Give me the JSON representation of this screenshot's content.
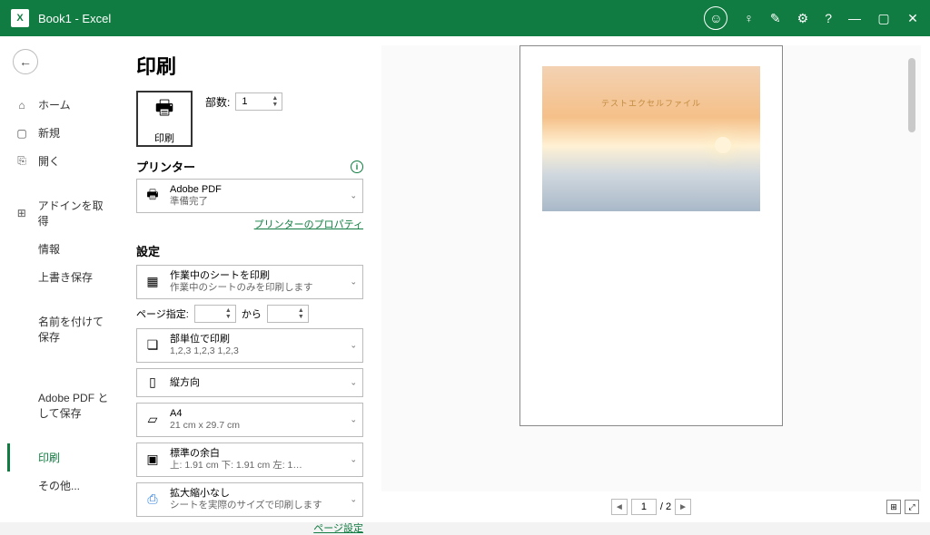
{
  "titlebar": {
    "title": "Book1  -  Excel"
  },
  "sidebar": {
    "home": "ホーム",
    "new": "新規",
    "open": "開く",
    "addins": "アドインを取得",
    "info": "情報",
    "save": "上書き保存",
    "saveas": "名前を付けて保存",
    "saveas_pdf": "Adobe PDF として保存",
    "print": "印刷",
    "other": "その他..."
  },
  "print": {
    "title": "印刷",
    "big_button": "印刷",
    "copies_label": "部数:",
    "copies_value": "1",
    "printer_heading": "プリンター",
    "printer_name": "Adobe PDF",
    "printer_status": "準備完了",
    "printer_props_link": "プリンターのプロパティ",
    "settings_heading": "設定",
    "scope_title": "作業中のシートを印刷",
    "scope_sub": "作業中のシートのみを印刷します",
    "page_range_label": "ページ指定:",
    "page_range_to": "から",
    "collate_title": "部単位で印刷",
    "collate_sub": "1,2,3    1,2,3    1,2,3",
    "orientation": "縦方向",
    "paper_title": "A4",
    "paper_sub": "21 cm x 29.7 cm",
    "margins_title": "標準の余白",
    "margins_sub": "上: 1.91 cm 下: 1.91 cm 左: 1…",
    "scaling_title": "拡大縮小なし",
    "scaling_sub": "シートを実際のサイズで印刷します",
    "page_setup_link": "ページ設定",
    "preview_caption": "テストエクセルファイル",
    "page_current": "1",
    "page_total": "/ 2"
  }
}
